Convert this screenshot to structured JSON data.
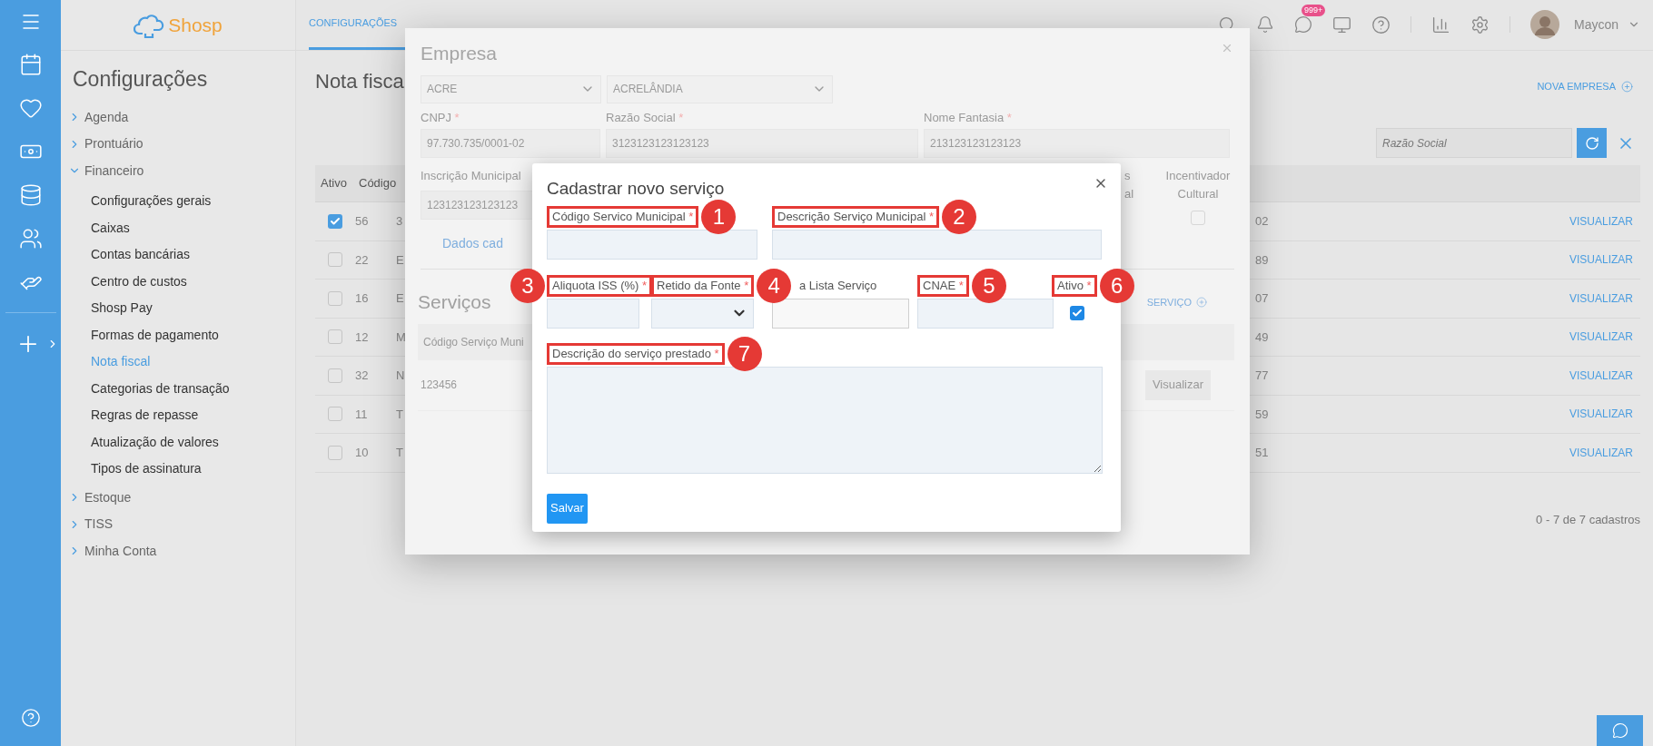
{
  "logo": {
    "text": "Shosp"
  },
  "sidebar": {
    "title": "Configurações",
    "items": [
      {
        "label": "Agenda",
        "expanded": false
      },
      {
        "label": "Prontuário",
        "expanded": false
      },
      {
        "label": "Financeiro",
        "expanded": true,
        "children": [
          {
            "label": "Configurações gerais",
            "selected": false
          },
          {
            "label": "Caixas",
            "selected": false
          },
          {
            "label": "Contas bancárias",
            "selected": false
          },
          {
            "label": "Centro de custos",
            "selected": false
          },
          {
            "label": "Shosp Pay",
            "selected": false
          },
          {
            "label": "Formas de pagamento",
            "selected": false
          },
          {
            "label": "Nota fiscal",
            "selected": true
          },
          {
            "label": "Categorias de transação",
            "selected": false
          },
          {
            "label": "Regras de repasse",
            "selected": false
          },
          {
            "label": "Atualização de valores",
            "selected": false
          },
          {
            "label": "Tipos de assinatura",
            "selected": false
          }
        ]
      },
      {
        "label": "Estoque",
        "expanded": false
      },
      {
        "label": "TISS",
        "expanded": false
      },
      {
        "label": "Minha Conta",
        "expanded": false
      }
    ]
  },
  "header": {
    "tabs": [
      {
        "label": "CONFIGURAÇÕES",
        "selected": true
      }
    ],
    "messages_badge": "999+",
    "user": "Maycon"
  },
  "page": {
    "title": "Nota fisca",
    "new_button": "NOVA EMPRESA",
    "search": {
      "placeholder": "Razão Social"
    },
    "table": {
      "columns": [
        "Ativo",
        "Código"
      ],
      "rows": [
        {
          "checked": true,
          "code": "56",
          "column_3": "3",
          "column_4": "02",
          "action": "VISUALIZAR"
        },
        {
          "checked": false,
          "code": "22",
          "column_3": "E",
          "column_4": "89",
          "action": "VISUALIZAR"
        },
        {
          "checked": false,
          "code": "16",
          "column_3": "E",
          "column_4": "07",
          "action": "VISUALIZAR"
        },
        {
          "checked": false,
          "code": "12",
          "column_3": "M",
          "column_4": "49",
          "action": "VISUALIZAR"
        },
        {
          "checked": false,
          "code": "32",
          "column_3": "N",
          "column_4": "77",
          "action": "VISUALIZAR"
        },
        {
          "checked": false,
          "code": "11",
          "column_3": "T",
          "column_4": "59",
          "action": "VISUALIZAR"
        },
        {
          "checked": false,
          "code": "10",
          "column_3": "T",
          "column_4": "51",
          "action": "VISUALIZAR"
        }
      ]
    },
    "pagination": "0 - 7 de 7 cadastros"
  },
  "empresa_modal": {
    "title": "Empresa",
    "selects": [
      "ACRE",
      "ACRELÂNDIA"
    ],
    "fields": [
      {
        "label": "CNPJ",
        "required_mark": "*",
        "value": "97.730.735/0001-02"
      },
      {
        "label": "Razão Social",
        "required_mark": "*",
        "value": "3123123123123123"
      },
      {
        "label": "Nome Fantasia",
        "required_mark": "*",
        "value": "213123123123123"
      }
    ],
    "municipal": {
      "label": "Inscrição Municipal",
      "value": "123123123123123"
    },
    "partial_label": [
      "s",
      "al"
    ],
    "cultural": {
      "label": "Incentivador Cultural",
      "checked": false
    },
    "link": "Dados cad",
    "services": {
      "title": "Serviços",
      "add_link": "SERVIÇO",
      "columns": [
        "Código Serviço Muni"
      ],
      "rows": [
        {
          "code": "123456",
          "action": "Visualizar"
        }
      ]
    }
  },
  "service_modal": {
    "title": "Cadastrar novo serviço",
    "fields": [
      {
        "kind": "input",
        "label": "Código Servico Municipal",
        "required_mark": "*",
        "marker": "1"
      },
      {
        "kind": "input",
        "label": "Descrição Serviço Municipal",
        "required_mark": "*",
        "marker": "2"
      },
      {
        "kind": "input",
        "label": "Aliquota ISS (%)",
        "required_mark": "*",
        "marker": "3"
      },
      {
        "kind": "select",
        "label": "Retido da Fonte",
        "required_mark": "*",
        "marker": "4"
      },
      {
        "kind": "input",
        "label": "a Lista Serviço",
        "disabled": true
      },
      {
        "kind": "input",
        "label": "CNAE",
        "required_mark": "*",
        "marker": "5"
      },
      {
        "kind": "checkbox",
        "label": "Ativo",
        "required_mark": "*",
        "checked": true,
        "marker": "6"
      },
      {
        "kind": "textarea",
        "label": "Descrição do serviço prestado",
        "required_mark": "*",
        "marker": "7"
      }
    ],
    "save_button": "Salvar"
  }
}
